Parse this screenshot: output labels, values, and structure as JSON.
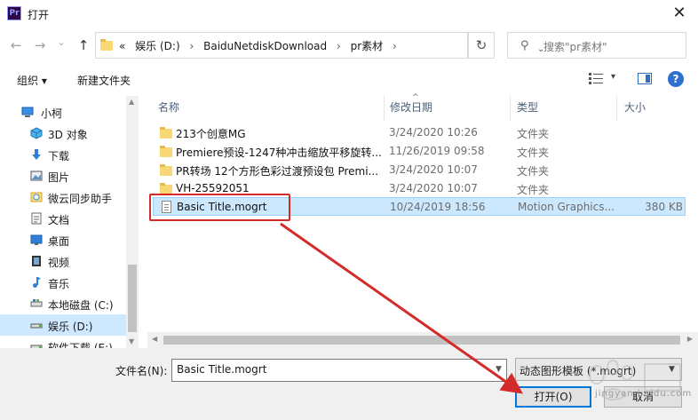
{
  "window": {
    "title": "打开",
    "app_icon_text": "Pr",
    "close_glyph": "✕"
  },
  "nav": {
    "back_glyph": "←",
    "forward_glyph": "→",
    "recent_glyph": "⌄",
    "up_glyph": "↑",
    "breadcrumb_prefix": "«",
    "breadcrumbs": [
      "娱乐 (D:)",
      "BaiduNetdiskDownload",
      "pr素材"
    ],
    "crumb_separator": "›",
    "refresh_glyph": "↻",
    "search_placeholder": "搜索\"pr素材\""
  },
  "toolbar": {
    "organize_label": "组织 ▾",
    "new_folder_label": "新建文件夹",
    "view_dropdown_glyph": "▾",
    "help_label": "?"
  },
  "sidebar": {
    "items": [
      {
        "label": "小柯",
        "icon": "computer-icon",
        "selected": false
      },
      {
        "label": "3D 对象",
        "icon": "cube-icon",
        "selected": false
      },
      {
        "label": "下载",
        "icon": "download-icon",
        "selected": false
      },
      {
        "label": "图片",
        "icon": "pictures-icon",
        "selected": false
      },
      {
        "label": "微云同步助手",
        "icon": "cloud-sync-icon",
        "selected": false
      },
      {
        "label": "文档",
        "icon": "documents-icon",
        "selected": false
      },
      {
        "label": "桌面",
        "icon": "desktop-icon",
        "selected": false
      },
      {
        "label": "视频",
        "icon": "videos-icon",
        "selected": false
      },
      {
        "label": "音乐",
        "icon": "music-icon",
        "selected": false
      },
      {
        "label": "本地磁盘 (C:)",
        "icon": "drive-icon",
        "selected": false
      },
      {
        "label": "娱乐 (D:)",
        "icon": "drive-icon",
        "selected": true
      },
      {
        "label": "软件下载 (E:)",
        "icon": "drive-icon",
        "selected": false
      }
    ]
  },
  "files": {
    "columns": {
      "name": "名称",
      "date": "修改日期",
      "type": "类型",
      "size": "大小"
    },
    "rows": [
      {
        "name": "213个创意MG",
        "date": "3/24/2020 10:26",
        "type": "文件夹",
        "size": "",
        "kind": "folder"
      },
      {
        "name": "Premiere预设-1247种冲击缩放平移旋转...",
        "date": "11/26/2019 09:58",
        "type": "文件夹",
        "size": "",
        "kind": "folder"
      },
      {
        "name": "PR转场 12个方形色彩过渡预设包 Premi...",
        "date": "3/24/2020 10:07",
        "type": "文件夹",
        "size": "",
        "kind": "folder"
      },
      {
        "name": "VH-25592051",
        "date": "3/24/2020 10:07",
        "type": "文件夹",
        "size": "",
        "kind": "folder"
      },
      {
        "name": "Basic Title.mogrt",
        "date": "10/24/2019 18:56",
        "type": "Motion Graphics...",
        "size": "380 KB",
        "kind": "file",
        "selected": true
      }
    ]
  },
  "bottom": {
    "filename_label": "文件名(N):",
    "filename_value": "Basic Title.mogrt",
    "filetype_value": "动态图形模板 (*.mogrt)",
    "open_label": "打开(O)",
    "cancel_label": "取消"
  },
  "watermark": {
    "text": "jingyan.baidu.com"
  },
  "colors": {
    "annotation_red": "#d42a2a",
    "selection_blue": "#cce8ff",
    "accent": "#0078d7"
  }
}
